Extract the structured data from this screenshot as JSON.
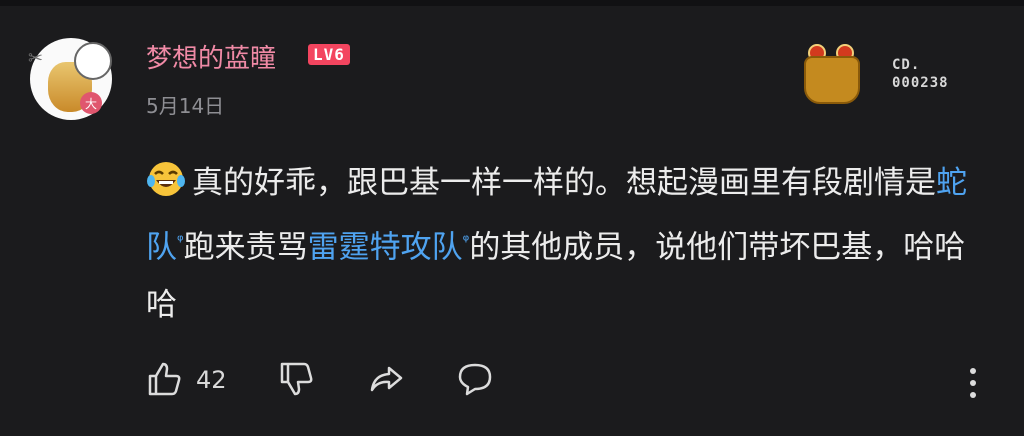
{
  "user": {
    "name": "梦想的蓝瞳",
    "level": "LV6",
    "date": "5月14日",
    "avatar_badge": "大"
  },
  "badge": {
    "line1": "CD.",
    "line2": "000238"
  },
  "comment": {
    "part1": "真的好乖，跟巴基一样一样的。想起漫画里有段剧情是",
    "link1": "蛇队",
    "part2": "跑来责骂",
    "link2": "雷霆特攻队",
    "part3": "的其他成员，说他们带坏巴基，哈哈哈",
    "link_search_mark": "ᵠ"
  },
  "actions": {
    "like_count": "42"
  },
  "colors": {
    "background": "#1b1b1d",
    "username": "#f08aa6",
    "level_badge": "#f3455f",
    "link": "#4fa3f0"
  },
  "icons": [
    "laughing-crying-emoji",
    "thumbs-up-icon",
    "thumbs-down-icon",
    "share-icon",
    "comment-icon",
    "more-vertical-icon"
  ]
}
